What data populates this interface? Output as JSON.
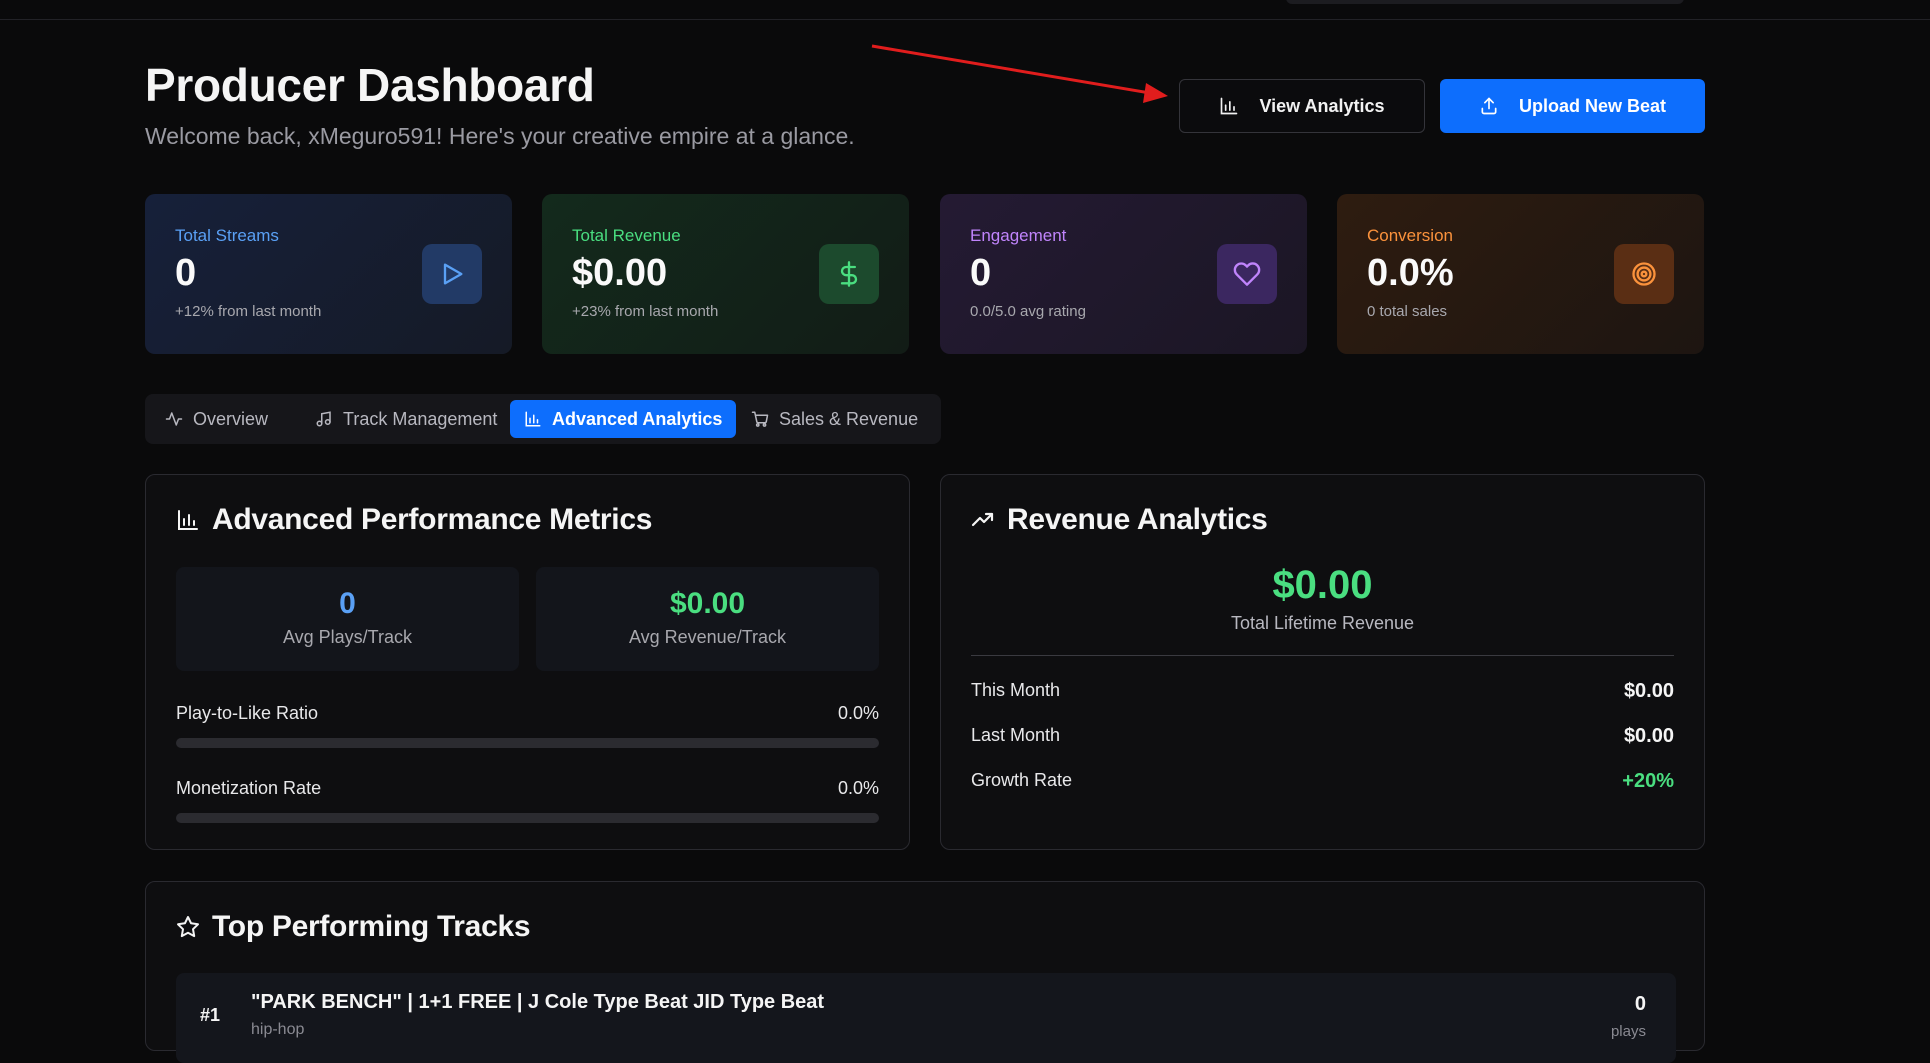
{
  "header": {
    "title": "Producer Dashboard",
    "subtitle": "Welcome back, xMeguro591! Here's your creative empire at a glance.",
    "view_analytics_label": "View Analytics",
    "upload_label": "Upload New Beat"
  },
  "stats": [
    {
      "label": "Total Streams",
      "value": "0",
      "sub": "+12% from last month",
      "icon": "play-icon",
      "color": "#5aa0f5"
    },
    {
      "label": "Total Revenue",
      "value": "$0.00",
      "sub": "+23% from last month",
      "icon": "dollar-icon",
      "color": "#4ade80"
    },
    {
      "label": "Engagement",
      "value": "0",
      "sub": "0.0/5.0 avg rating",
      "icon": "heart-icon",
      "color": "#c084fc"
    },
    {
      "label": "Conversion",
      "value": "0.0%",
      "sub": "0 total sales",
      "icon": "target-icon",
      "color": "#fb923c"
    }
  ],
  "tabs": [
    {
      "label": "Overview",
      "icon": "activity-icon",
      "active": false
    },
    {
      "label": "Track Management",
      "icon": "music-note-icon",
      "active": false
    },
    {
      "label": "Advanced Analytics",
      "icon": "bar-chart-icon",
      "active": true
    },
    {
      "label": "Sales & Revenue",
      "icon": "cart-icon",
      "active": false
    }
  ],
  "performance": {
    "title": "Advanced Performance Metrics",
    "avg_plays_value": "0",
    "avg_plays_label": "Avg Plays/Track",
    "avg_revenue_value": "$0.00",
    "avg_revenue_label": "Avg Revenue/Track",
    "metrics": [
      {
        "label": "Play-to-Like Ratio",
        "value": "0.0%",
        "fraction": 0.0
      },
      {
        "label": "Monetization Rate",
        "value": "0.0%",
        "fraction": 0.0
      }
    ]
  },
  "revenue": {
    "title": "Revenue Analytics",
    "total_value": "$0.00",
    "total_label": "Total Lifetime Revenue",
    "rows": [
      {
        "label": "This Month",
        "value": "$0.00"
      },
      {
        "label": "Last Month",
        "value": "$0.00"
      },
      {
        "label": "Growth Rate",
        "value": "+20%"
      }
    ]
  },
  "top_tracks": {
    "title": "Top Performing Tracks",
    "items": [
      {
        "rank": "#1",
        "title": "\"PARK BENCH\" | 1+1 FREE | J Cole Type Beat JID Type Beat",
        "genre": "hip-hop",
        "plays": "0",
        "plays_label": "plays"
      }
    ]
  },
  "colors": {
    "accent": "#0d6efd",
    "positive": "#4ade80",
    "annotation_arrow": "#e11d1d"
  }
}
